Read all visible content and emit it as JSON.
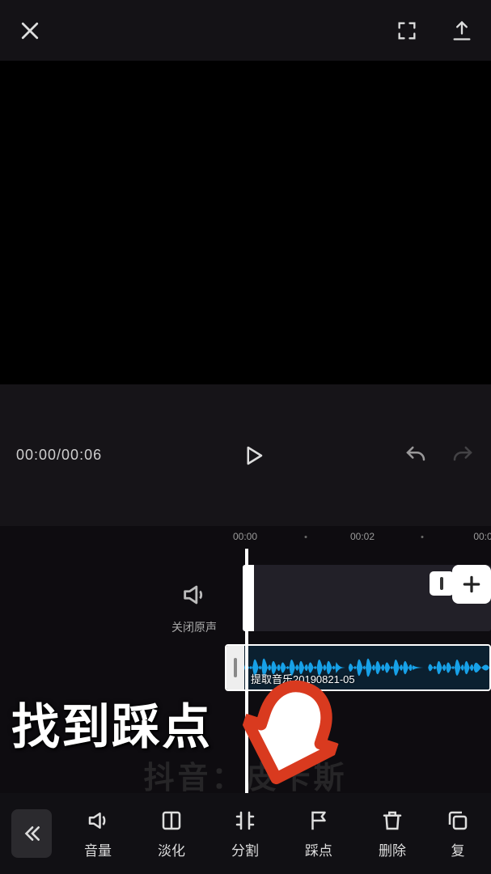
{
  "transport": {
    "timecode": "00:00/00:06"
  },
  "ruler": {
    "t0": "00:00",
    "t1": "00:02",
    "t2": "00:0"
  },
  "mute": {
    "label": "关闭原声"
  },
  "audio": {
    "label": "提取音乐20190821-05"
  },
  "annotation": {
    "text": "找到踩点"
  },
  "watermark": {
    "text": "抖音：皮卡斯"
  },
  "toolbar": {
    "volume": "音量",
    "fade": "淡化",
    "split": "分割",
    "beat": "踩点",
    "delete": "删除",
    "copy": "复"
  }
}
